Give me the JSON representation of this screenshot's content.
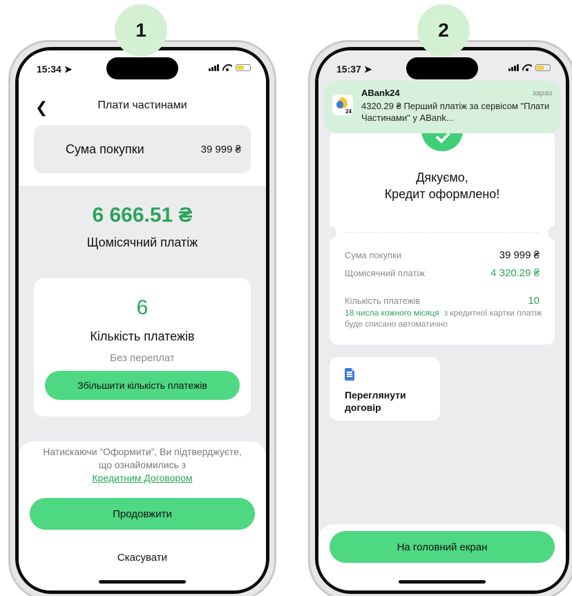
{
  "steps": {
    "first": "1",
    "second": "2"
  },
  "screen1": {
    "status_time": "15:34",
    "title": "Плати частинами",
    "purchase_label": "Сума покупки",
    "purchase_value": "39 999 ₴",
    "monthly_amount": "6 666.51 ₴",
    "monthly_label": "Щомісячний платіж",
    "payments_count": "6",
    "payments_label": "Кількість платежів",
    "payments_sub": "Без переплат",
    "increase_button": "Збільшити кількість платежів",
    "consent_text": "Натискаючи “Оформити”, Ви підтверджуєте, що ознайомились з",
    "consent_link": "Кредитним Договором",
    "continue_button": "Продовжити",
    "cancel_button": "Скасувати"
  },
  "screen2": {
    "status_time": "15:37",
    "notification": {
      "app_name": "ABank24",
      "time": "зараз",
      "icon_badge": "24",
      "body": "4320.29 ₴ Перший платіж за сервісом \"Плати Частинами\" у ABank..."
    },
    "thanks_line1": "Дякуємо,",
    "thanks_line2": "Кредит оформлено!",
    "rows": [
      {
        "label": "Сума покупки",
        "value": "39 999 ₴"
      },
      {
        "label": "Щомісячний платіж",
        "value": "4 320.29 ₴"
      },
      {
        "label": "Кількість платежів",
        "value": "10"
      }
    ],
    "schedule_highlight": "18 числа кожного місяця",
    "schedule_rest": "з кредитної картки платіж буде списано автоматично",
    "contract_button": "Переглянути договір",
    "home_button": "На головний екран"
  },
  "colors": {
    "accent": "#4ed882",
    "accent_text": "#2aa35b",
    "badge": "#d4f0d3",
    "notification": "#d6f0dc",
    "doc_icon": "#3a7bd5"
  },
  "icons": [
    "back-chevron-icon",
    "location-arrow-icon",
    "signal-icon",
    "wifi-icon",
    "battery-icon",
    "check-icon",
    "document-icon",
    "abank-app-icon"
  ]
}
